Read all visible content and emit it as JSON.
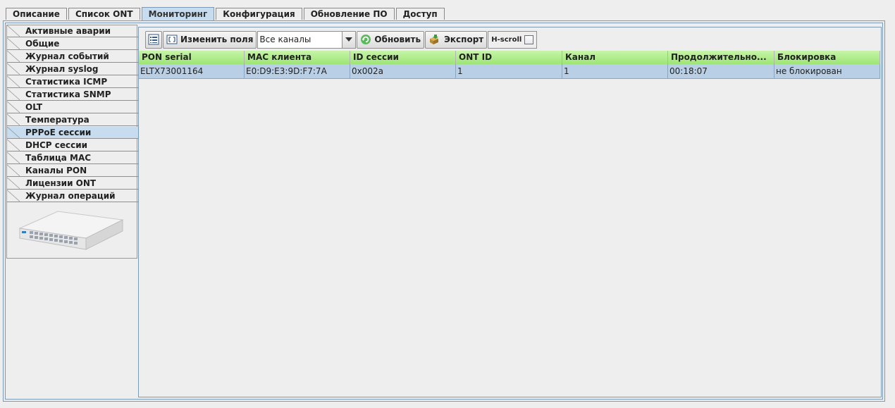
{
  "tabs": [
    {
      "label": "Описание",
      "active": false
    },
    {
      "label": "Список ONT",
      "active": false
    },
    {
      "label": "Мониторинг",
      "active": true
    },
    {
      "label": "Конфигурация",
      "active": false
    },
    {
      "label": "Обновление ПО",
      "active": false
    },
    {
      "label": "Доступ",
      "active": false
    }
  ],
  "sidebar": {
    "items": [
      {
        "label": "Активные аварии",
        "active": false
      },
      {
        "label": "Общие",
        "active": false
      },
      {
        "label": "Журнал событий",
        "active": false
      },
      {
        "label": "Журнал syslog",
        "active": false
      },
      {
        "label": "Статистика ICMP",
        "active": false
      },
      {
        "label": "Статистика SNMP",
        "active": false
      },
      {
        "label": "OLT",
        "active": false
      },
      {
        "label": "Температура",
        "active": false
      },
      {
        "label": "PPPoE сессии",
        "active": true
      },
      {
        "label": "DHCP сессии",
        "active": false
      },
      {
        "label": "Таблица MAC",
        "active": false
      },
      {
        "label": "Каналы PON",
        "active": false
      },
      {
        "label": "Лицензии ONT",
        "active": false
      },
      {
        "label": "Журнал операций",
        "active": false
      }
    ]
  },
  "toolbar": {
    "edit_fields_label": "Изменить поля",
    "channel_select": "Все каналы",
    "refresh_label": "Обновить",
    "export_label": "Экспорт",
    "hscroll_label": "H-scroll",
    "hscroll_checked": false
  },
  "table": {
    "columns": [
      "PON serial",
      "MAC клиента",
      "ID сессии",
      "ONT ID",
      "Канал",
      "Продолжительно...",
      "Блокировка"
    ],
    "rows": [
      [
        "ELTX73001164",
        "E0:D9:E3:9D:F7:7A",
        "0x002a",
        "1",
        "1",
        "00:18:07",
        "не блокирован"
      ]
    ]
  },
  "colors": {
    "accent": "#c7dcee",
    "header_green": "#9de575",
    "row_selected": "#b8cfe6"
  }
}
